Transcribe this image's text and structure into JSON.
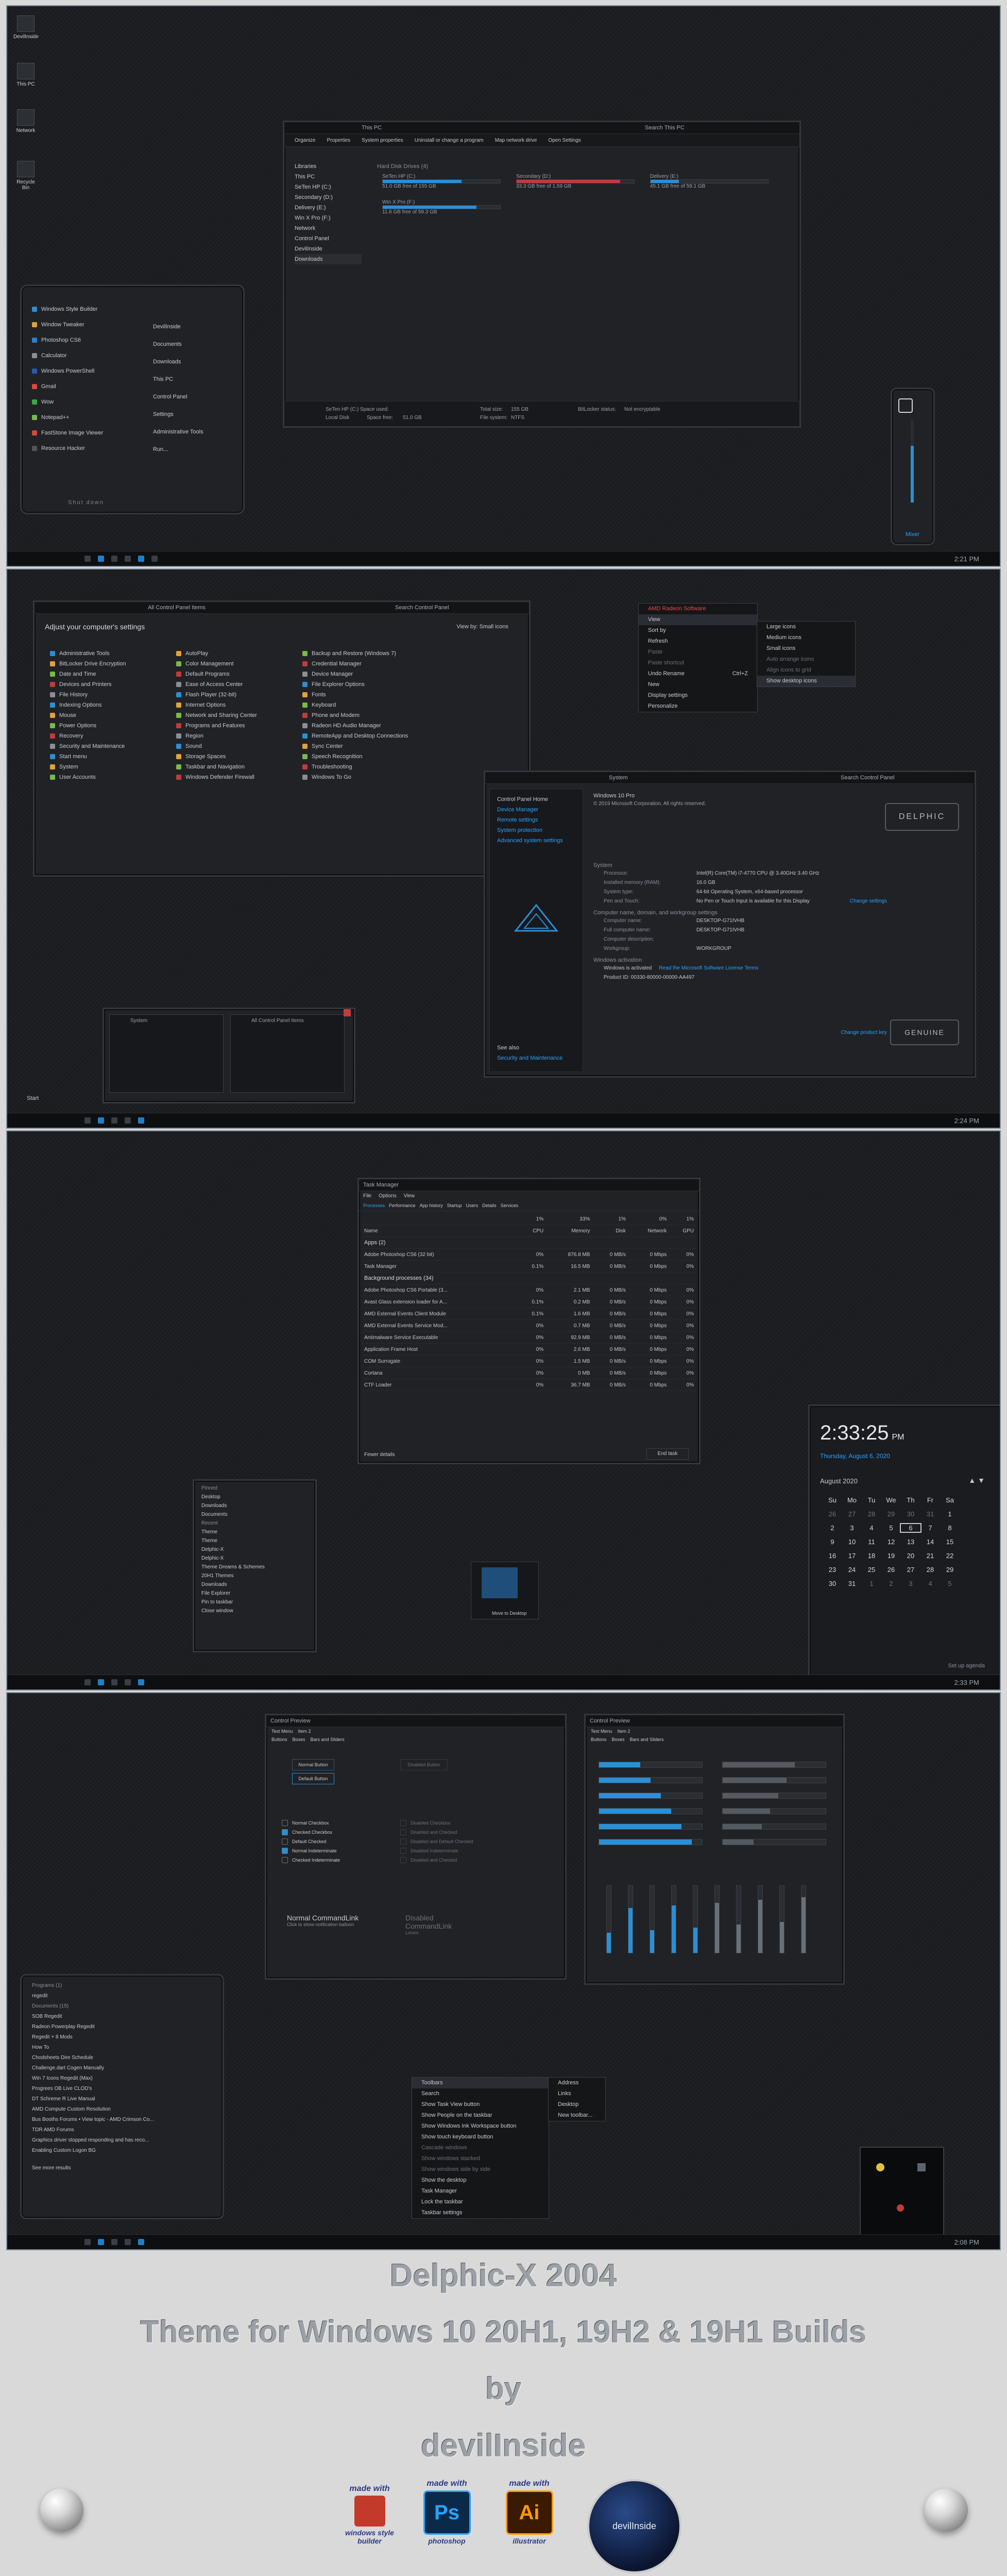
{
  "shot1": {
    "desktop_icons": [
      "DevilInside",
      "This PC",
      "Network",
      "Recycle Bin"
    ],
    "explorer": {
      "title": "This PC",
      "search_placeholder": "Search This PC",
      "ribbon": [
        "Organize",
        "Properties",
        "System properties",
        "Uninstall or change a program",
        "Map network drive",
        "Open Settings"
      ],
      "nav": [
        "Libraries",
        "This PC",
        "SeTen HP (C:)",
        "Secondary (D:)",
        "Delivery (E:)",
        "Win X Pro (F:)",
        "Network",
        "Control Panel",
        "DevilInside",
        "Downloads"
      ],
      "section": "Hard Disk Drives (4)",
      "drives": [
        {
          "name": "SeTen HP (C:)",
          "free": "51.0 GB free of 155 GB",
          "pct": 67
        },
        {
          "name": "Secondary (D:)",
          "free": "33.3 GB free of 1.59 GB",
          "pct": 88
        },
        {
          "name": "Delivery (E:)",
          "free": "45.1 GB free of 59.1 GB",
          "pct": 24
        },
        {
          "name": "Win X Pro (F:)",
          "free": "11.6 GB free of 59.3 GB",
          "pct": 80
        }
      ],
      "status": {
        "drive": "SeTen HP (C:) Space used:",
        "local": "Local Disk",
        "space_free": "Space free:",
        "free_val": "51.0 GB",
        "total_label": "Total size:",
        "total": "155 GB",
        "fs_label": "File system:",
        "fs": "NTFS",
        "bitlocker": "BitLocker status:",
        "bitlocker_val": "Not encryptable"
      }
    },
    "start_menu": {
      "left": [
        "Windows Style Builder",
        "Window Tweaker",
        "Photoshop CS6",
        "Calculator",
        "Windows PowerShell",
        "Gmail",
        "Wow",
        "Notepad++",
        "FastStone Image Viewer",
        "Resource Hacker"
      ],
      "right": [
        "DevilInside",
        "Documents",
        "Downloads",
        "This PC",
        "Control Panel",
        "Settings",
        "Administrative Tools",
        "Run..."
      ],
      "power": "Shut down"
    },
    "volume_label": "Mixer",
    "clock": "2:21 PM"
  },
  "shot2": {
    "cp": {
      "title": "All Control Panel Items",
      "search": "Search Control Panel",
      "heading": "Adjust your computer's settings",
      "view_by": "View by:",
      "view_val": "Small icons",
      "col1": [
        "Administrative Tools",
        "BitLocker Drive Encryption",
        "Date and Time",
        "Devices and Printers",
        "File History",
        "Indexing Options",
        "Mouse",
        "Power Options",
        "Recovery",
        "Security and Maintenance",
        "Start menu",
        "System",
        "User Accounts"
      ],
      "col2": [
        "AutoPlay",
        "Color Management",
        "Default Programs",
        "Ease of Access Center",
        "Flash Player (32-bit)",
        "Internet Options",
        "Network and Sharing Center",
        "Programs and Features",
        "Region",
        "Sound",
        "Storage Spaces",
        "Taskbar and Navigation",
        "Windows Defender Firewall"
      ],
      "col3": [
        "Backup and Restore (Windows 7)",
        "Credential Manager",
        "Device Manager",
        "File Explorer Options",
        "Fonts",
        "Keyboard",
        "Phone and Modem",
        "Radeon HD Audio Manager",
        "RemoteApp and Desktop Connections",
        "Sync Center",
        "Speech Recognition",
        "Troubleshooting",
        "Windows To Go"
      ]
    },
    "ctx": {
      "header": "AMD Radeon Software",
      "items": [
        "View",
        "Sort by",
        "Refresh",
        "Paste",
        "Paste shortcut",
        "Undo Rename",
        "New",
        "Display settings",
        "Personalize"
      ],
      "undo_key": "Ctrl+Z",
      "sub": [
        "Large icons",
        "Medium icons",
        "Small icons",
        "Auto arrange icons",
        "Align icons to grid",
        "Show desktop icons"
      ]
    },
    "system": {
      "title": "System",
      "search": "Search Control Panel",
      "left": [
        "Control Panel Home",
        "Device Manager",
        "Remote settings",
        "System protection",
        "Advanced system settings"
      ],
      "see_also": "See also",
      "sec_maint": "Security and Maintenance",
      "edition": "Windows 10 Pro",
      "copyright": "© 2019 Microsoft Corporation. All rights reserved.",
      "system_label": "System",
      "rows": [
        [
          "Processor:",
          "Intel(R) Core(TM) i7-4770 CPU @ 3.40GHz 3.40 GHz"
        ],
        [
          "Installed memory (RAM):",
          "16.0 GB"
        ],
        [
          "System type:",
          "64-bit Operating System, x64-based processor"
        ],
        [
          "Pen and Touch:",
          "No Pen or Touch Input is available for this Display"
        ]
      ],
      "comp_label": "Computer name, domain, and workgroup settings",
      "comp_rows": [
        [
          "Computer name:",
          "DESKTOP-G71IVHB"
        ],
        [
          "Full computer name:",
          "DESKTOP-G71IVHB"
        ],
        [
          "Computer description:",
          ""
        ],
        [
          "Workgroup:",
          "WORKGROUP"
        ]
      ],
      "change_settings": "Change settings",
      "activation_label": "Windows activation",
      "activated": "Windows is activated",
      "license": "Read the Microsoft Software License Terms",
      "product_id": "Product ID: 00330-80000-00000-AA497",
      "change_key": "Change product key",
      "logo": "DELPHIC",
      "genuine": "GENUINE"
    },
    "thumbs": [
      "System",
      "All Control Panel Items"
    ],
    "start": "Start",
    "clock": "2:24 PM"
  },
  "shot3": {
    "tm": {
      "title": "Task Manager",
      "menu": [
        "File",
        "Options",
        "View"
      ],
      "tabs": [
        "Processes",
        "Performance",
        "App history",
        "Startup",
        "Users",
        "Details",
        "Services"
      ],
      "headers": [
        "Name",
        "CPU",
        "Memory",
        "Disk",
        "Network",
        "GPU"
      ],
      "usage": [
        "1%",
        "33%",
        "1%",
        "0%",
        "1%"
      ],
      "apps_label": "Apps (2)",
      "apps": [
        [
          "Adobe Photoshop CS6 (32 bit)",
          "0%",
          "876.8 MB",
          "0 MB/s",
          "0 Mbps",
          "0%"
        ],
        [
          "Task Manager",
          "0.1%",
          "16.5 MB",
          "0 MB/s",
          "0 Mbps",
          "0%"
        ]
      ],
      "bg_label": "Background processes (34)",
      "bg": [
        [
          "Adobe Photoshop CS6 Portable (3...",
          "0%",
          "2.1 MB",
          "0 MB/s",
          "0 Mbps",
          "0%"
        ],
        [
          "Avast Glass extension loader for A...",
          "0.1%",
          "0.2 MB",
          "0 MB/s",
          "0 Mbps",
          "0%"
        ],
        [
          "AMD External Events Client Module",
          "0.1%",
          "1.6 MB",
          "0 MB/s",
          "0 Mbps",
          "0%"
        ],
        [
          "AMD External Events Service Mod...",
          "0%",
          "0.7 MB",
          "0 MB/s",
          "0 Mbps",
          "0%"
        ],
        [
          "Antimalware Service Executable",
          "0%",
          "92.9 MB",
          "0 MB/s",
          "0 Mbps",
          "0%"
        ],
        [
          "Application Frame Host",
          "0%",
          "2.6 MB",
          "0 MB/s",
          "0 Mbps",
          "0%"
        ],
        [
          "COM Surrogate",
          "0%",
          "1.5 MB",
          "0 MB/s",
          "0 Mbps",
          "0%"
        ],
        [
          "Cortana",
          "0%",
          "0 MB",
          "0 MB/s",
          "0 Mbps",
          "0%"
        ],
        [
          "CTF Loader",
          "0%",
          "36.7 MB",
          "0 MB/s",
          "0 Mbps",
          "0%"
        ]
      ],
      "fewer": "Fewer details",
      "end": "End task"
    },
    "jump": {
      "pinned": "Pinned",
      "pinned_items": [
        "Desktop",
        "Downloads",
        "Documents"
      ],
      "recent": "Recent",
      "recent_items": [
        "Theme",
        "Theme",
        "Delphic-X",
        "Delphic-X",
        "Theme Dreams & Schemes",
        "20H1 Themes",
        "Downloads"
      ],
      "actions": [
        "File Explorer",
        "Pin to taskbar",
        "Close window"
      ]
    },
    "move_label": "Move to Desktop",
    "cal": {
      "time": "2:33:25",
      "ampm": "PM",
      "date": "Thursday, August 6, 2020",
      "month": "August 2020",
      "dows": [
        "Su",
        "Mo",
        "Tu",
        "We",
        "Th",
        "Fr",
        "Sa"
      ],
      "days": [
        "26",
        "27",
        "28",
        "29",
        "30",
        "31",
        "1",
        "2",
        "3",
        "4",
        "5",
        "6",
        "7",
        "8",
        "9",
        "10",
        "11",
        "12",
        "13",
        "14",
        "15",
        "16",
        "17",
        "18",
        "19",
        "20",
        "21",
        "22",
        "23",
        "24",
        "25",
        "26",
        "27",
        "28",
        "29",
        "30",
        "31",
        "1",
        "2",
        "3",
        "4",
        "5"
      ],
      "agenda": "Set up agenda"
    },
    "clock": "2:33 PM"
  },
  "shot4": {
    "cp_a": {
      "title": "Control Preview",
      "menu": [
        "Test Menu",
        "Item 2"
      ],
      "tabs": [
        "Buttons",
        "Boxes",
        "Bars and Sliders"
      ],
      "btn1": "Normal Button",
      "btn2": "Default Button",
      "btn3": "Disabled Button",
      "checks": [
        "Normal Checkbox",
        "Checked Checkbox",
        "Default Checked",
        "Normal Indeterminate",
        "Checked Indeterminate"
      ],
      "checks_dis": [
        "Disabled Checkbox",
        "Disabled and Checked",
        "Disabled and Default Checked",
        "Disabled Indeterminate",
        "Disabled and Checked"
      ],
      "cmd_title": "Normal CommandLink",
      "cmd_sub": "Click to show notification balloon",
      "cmd_dis": "Disabled CommandLink",
      "cmd_dis_sub": "Lorem"
    },
    "cp_b": {
      "title": "Control Preview",
      "menu": [
        "Test Menu",
        "Item 2"
      ],
      "tabs": [
        "Buttons",
        "Boxes",
        "Bars and Sliders"
      ]
    },
    "search_panel": {
      "apps": "Programs (1)",
      "app1": "regedit",
      "docs": "Documents (15)",
      "items": [
        "SOB Regedit",
        "Radeon Powerplay Regedit",
        "Regedit + 8 Mods",
        "How To",
        "Chodsheets Dire Schedule",
        "Challenge.dart Cogen Manually",
        "Win 7 Icons Regedit (Max)",
        "Progrees OB Live CLOD's",
        "DT Schreme R Live Manual",
        "AMD Compute Custom Resolution",
        "Bus Booths Forums • View topic - AMD Crimson Co...",
        "TDR AMD Forums",
        "Graphics driver stopped responding and has reco...",
        "Enabling Custom Logon BG"
      ],
      "more": "See more results"
    },
    "tb_menu": {
      "items": [
        "Toolbars",
        "Search",
        "Show Task View button",
        "Show People on the taskbar",
        "Show Windows Ink Workspace button",
        "Show touch keyboard button",
        "Cascade windows",
        "Show windows stacked",
        "Show windows side by side",
        "Show the desktop",
        "Task Manager",
        "Lock the taskbar",
        "Taskbar settings"
      ],
      "sub": [
        "Address",
        "Links",
        "Desktop",
        "New toolbar..."
      ]
    },
    "clock": "2:08 PM"
  },
  "caption": {
    "line1": "Delphic-X 2004",
    "line2": "Theme for Windows 10 20H1, 19H2 & 19H1 Builds",
    "line3": "by",
    "line4": "devilInside"
  },
  "badges": [
    {
      "made": "made with",
      "name": "windows style builder"
    },
    {
      "made": "made with",
      "name": "photoshop",
      "abbr": "Ps"
    },
    {
      "made": "made with",
      "name": "illustrator",
      "abbr": "Ai"
    },
    {
      "name": "devilInside"
    }
  ],
  "colors": {
    "accent": "#2b8fd6",
    "frame": "#7d8a99",
    "bg": "#1b1c1f"
  }
}
